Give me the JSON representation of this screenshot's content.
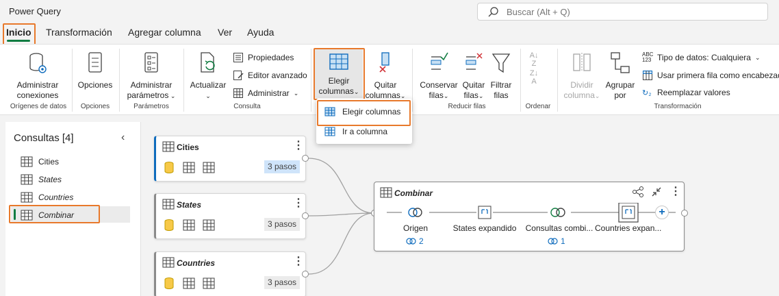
{
  "app": {
    "title": "Power Query"
  },
  "search": {
    "placeholder": "Buscar (Alt + Q)"
  },
  "tabs": [
    {
      "label": "Inicio",
      "active": true
    },
    {
      "label": "Transformación"
    },
    {
      "label": "Agregar columna"
    },
    {
      "label": "Ver"
    },
    {
      "label": "Ayuda"
    }
  ],
  "ribbon": {
    "admin_connections": "Administrar conexiones",
    "group_sources": "Orígenes de datos",
    "options": "Opciones",
    "group_options": "Opciones",
    "admin_params_1": "Administrar",
    "admin_params_2": "parámetros",
    "group_params": "Parámetros",
    "refresh": "Actualizar",
    "properties": "Propiedades",
    "advanced_editor": "Editor avanzado",
    "manage": "Administrar",
    "group_query": "Consulta",
    "choose_cols_1": "Elegir",
    "choose_cols_2": "columnas",
    "remove_cols_1": "Quitar",
    "remove_cols_2": "columnas",
    "keep_rows_1": "Conservar",
    "keep_rows_2": "filas",
    "remove_rows_1": "Quitar",
    "remove_rows_2": "filas",
    "filter_rows_1": "Filtrar",
    "filter_rows_2": "filas",
    "group_reduce": "Reducir filas",
    "group_sort": "Ordenar",
    "split_col_1": "Dividir",
    "split_col_2": "columna",
    "group_by_1": "Agrupar",
    "group_by_2": "por",
    "data_type": "Tipo de datos: Cualquiera",
    "first_row_header": "Usar primera fila como encabezado",
    "replace_values": "Reemplazar valores",
    "group_transform": "Transformación"
  },
  "dropdown": {
    "items": [
      "Elegir columnas",
      "Ir a columna"
    ]
  },
  "queries": {
    "title": "Consultas [4]",
    "items": [
      "Cities",
      "States",
      "Countries",
      "Combinar"
    ]
  },
  "canvas": {
    "cards": [
      {
        "title": "Cities",
        "steps": "3 pasos"
      },
      {
        "title": "States",
        "steps": "3 pasos"
      },
      {
        "title": "Countries",
        "steps": "3 pasos"
      }
    ],
    "combine": {
      "title": "Combinar",
      "steps": [
        {
          "label": "Origen",
          "count": "2"
        },
        {
          "label": "States expandido"
        },
        {
          "label": "Consultas combi...",
          "count": "1"
        },
        {
          "label": "Countries expan..."
        }
      ]
    }
  },
  "colors": {
    "accent": "#107c41",
    "highlight": "#e8792b",
    "selected_bar": "#0f6cbd"
  }
}
